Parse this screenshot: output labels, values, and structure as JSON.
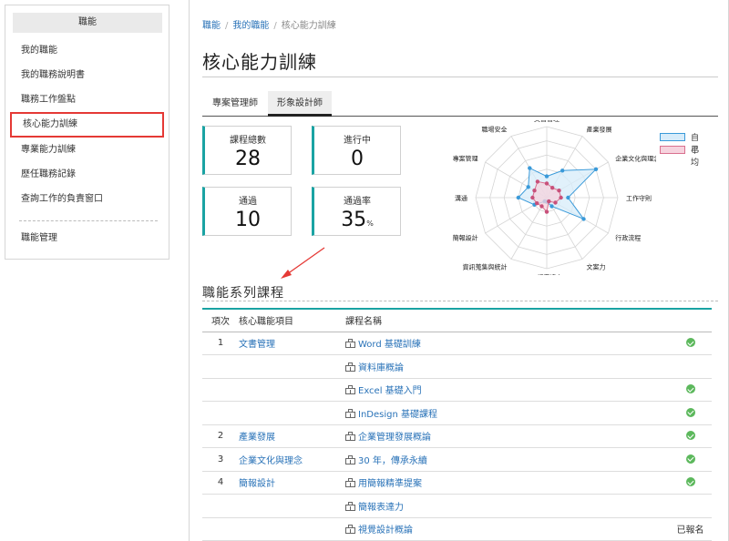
{
  "sidebar": {
    "header": "職能",
    "items": [
      {
        "label": "我的職能"
      },
      {
        "label": "我的職務說明書"
      },
      {
        "label": "職務工作盤點"
      },
      {
        "label": "核心能力訓練"
      },
      {
        "label": "專業能力訓練"
      },
      {
        "label": "歷任職務記錄"
      },
      {
        "label": "查詢工作的負責窗口"
      }
    ],
    "manage": "職能管理"
  },
  "breadcrumb": {
    "crumb1": "職能",
    "crumb2": "我的職能",
    "current": "核心能力訓練"
  },
  "page_title": "核心能力訓練",
  "tabs": [
    "專案管理師",
    "形象設計師"
  ],
  "stats": {
    "total_courses": {
      "label": "課程總數",
      "value": "28"
    },
    "in_progress": {
      "label": "進行中",
      "value": "0"
    },
    "passed": {
      "label": "通過",
      "value": "10"
    },
    "pass_rate": {
      "label": "通過率",
      "value": "35",
      "unit": "%"
    }
  },
  "chart_data": {
    "type": "radar",
    "axes": [
      "文書管理",
      "產業發展",
      "企業文化與理念",
      "工作守則",
      "行政流程",
      "文案力",
      "口語表達力",
      "資訊蒐集與統計",
      "簡報設計",
      "溝通",
      "專案管理",
      "職場安全"
    ],
    "scale_max": 5,
    "series": [
      {
        "name": "自己",
        "color": "#3a9ad9",
        "values": [
          1.5,
          2.2,
          4.0,
          1.5,
          3.0,
          0.7,
          0.3,
          0.3,
          1.0,
          2.0,
          1.5,
          2.4
        ]
      },
      {
        "name": "平均",
        "color": "#c8507a",
        "values": [
          1.0,
          0.8,
          1.0,
          1.0,
          0.7,
          0.3,
          1.0,
          0.7,
          0.8,
          1.0,
          1.0,
          1.3
        ]
      }
    ],
    "legend_position": "top-right",
    "legend_colors": {
      "self_fill": "#d7ecfa",
      "self_stroke": "#3a9ad9",
      "avg_fill": "#f6d3de",
      "avg_stroke": "#d9708f"
    }
  },
  "section_title": "職能系列課程",
  "table": {
    "headers": {
      "no": "項次",
      "item": "核心職能項目",
      "course": "課程名稱",
      "status": ""
    },
    "rows": [
      {
        "no": "1",
        "item": "文書管理",
        "course": "Word 基礎訓練",
        "status": "check"
      },
      {
        "no": "",
        "item": "",
        "course": "資料庫概論",
        "status": ""
      },
      {
        "no": "",
        "item": "",
        "course": "Excel 基礎入門",
        "status": "check"
      },
      {
        "no": "",
        "item": "",
        "course": "InDesign 基礎課程",
        "status": "check"
      },
      {
        "no": "2",
        "item": "產業發展",
        "course": "企業管理發展概論",
        "status": "check"
      },
      {
        "no": "3",
        "item": "企業文化與理念",
        "course": "30 年，傳承永續",
        "status": "check"
      },
      {
        "no": "4",
        "item": "簡報設計",
        "course": "用簡報精準提案",
        "status": "check"
      },
      {
        "no": "",
        "item": "",
        "course": "簡報表達力",
        "status": ""
      },
      {
        "no": "",
        "item": "",
        "course": "視覺設計概論",
        "status": "已報名"
      }
    ]
  },
  "colors": {
    "accent_teal": "#1aa3a3",
    "link_blue": "#2a73b8",
    "highlight_red": "#e53935",
    "check_green": "#5cb85c"
  }
}
